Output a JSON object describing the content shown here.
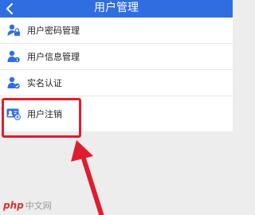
{
  "header": {
    "title": "用户管理",
    "back_icon": "chevron-left-icon",
    "bg_color": "#2f6ee0"
  },
  "menu": {
    "items": [
      {
        "label": "用户密码管理",
        "icon": "lock-user-icon"
      },
      {
        "label": "用户信息管理",
        "icon": "user-info-icon"
      },
      {
        "label": "实名认证",
        "icon": "verified-user-icon"
      },
      {
        "label": "用户注销",
        "icon": "id-card-cancel-icon"
      }
    ]
  },
  "watermark": {
    "logo": "php",
    "text": "中文网"
  },
  "annotation_color": "#e01d2e"
}
